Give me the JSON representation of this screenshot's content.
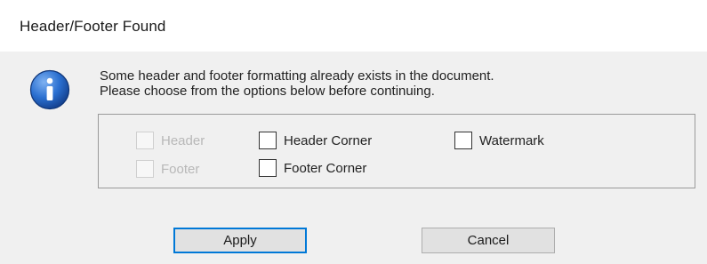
{
  "window": {
    "title": "Header/Footer Found"
  },
  "icon": {
    "name": "info-icon",
    "color": "#1e63c6"
  },
  "message": {
    "line1": "Some header and footer formatting already exists in the document.",
    "line2": "Please choose from the options below before continuing."
  },
  "options": {
    "header": {
      "label": "Header",
      "checked": false,
      "enabled": false
    },
    "footer": {
      "label": "Footer",
      "checked": false,
      "enabled": false
    },
    "header_corner": {
      "label": "Header Corner",
      "checked": false,
      "enabled": true
    },
    "footer_corner": {
      "label": "Footer Corner",
      "checked": false,
      "enabled": true
    },
    "watermark": {
      "label": "Watermark",
      "checked": false,
      "enabled": true
    }
  },
  "buttons": {
    "apply_label": "Apply",
    "cancel_label": "Cancel"
  },
  "colors": {
    "default_button_border": "#0078d7",
    "disabled_text": "#b8b8b8"
  }
}
